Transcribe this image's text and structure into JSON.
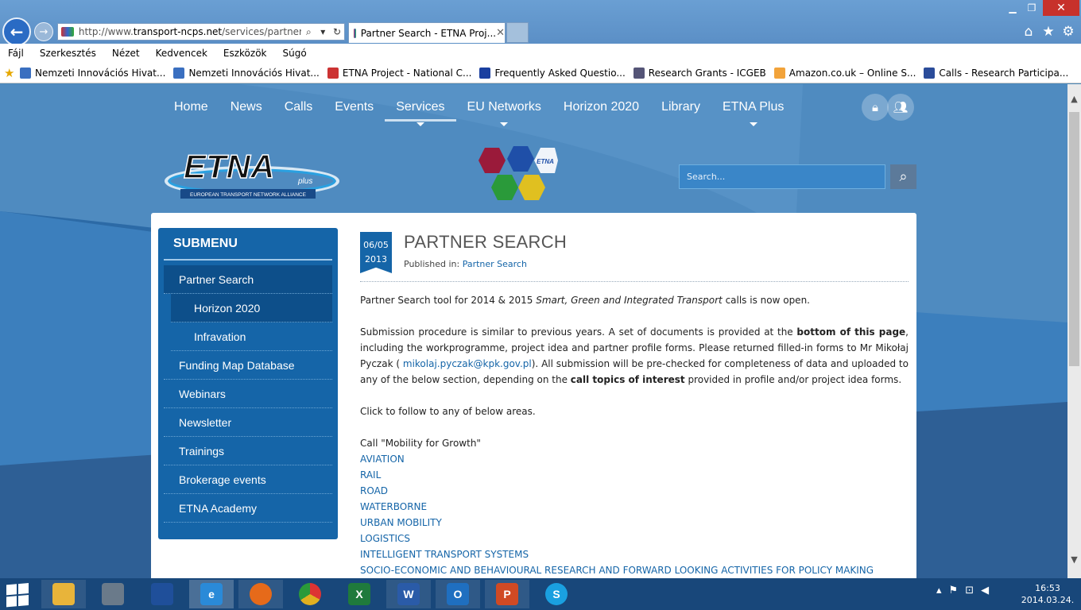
{
  "browser": {
    "url_prefix": "http://www.",
    "url_domain": "transport-ncps.net",
    "url_path": "/services/partner-searc",
    "tab_title": "Partner Search - ETNA Proj...",
    "tab_close": "✕",
    "menu": [
      "Fájl",
      "Szerkesztés",
      "Nézet",
      "Kedvencek",
      "Eszközök",
      "Súgó"
    ],
    "favorites": [
      {
        "label": "Nemzeti Innovációs Hivat...",
        "color": "#3a6fc0"
      },
      {
        "label": "Nemzeti Innovációs Hivat...",
        "color": "#3a6fc0"
      },
      {
        "label": "ETNA Project - National C...",
        "color": "#c33"
      },
      {
        "label": "Frequently Asked Questio...",
        "color": "#1a3fa0"
      },
      {
        "label": "Research Grants - ICGEB",
        "color": "#557"
      },
      {
        "label": "Amazon.co.uk – Online S...",
        "color": "#f2a33a"
      },
      {
        "label": "Calls - Research Participa...",
        "color": "#2b4c9a"
      }
    ]
  },
  "site": {
    "nav": [
      {
        "label": "Home",
        "dropdown": false
      },
      {
        "label": "News",
        "dropdown": false
      },
      {
        "label": "Calls",
        "dropdown": false
      },
      {
        "label": "Events",
        "dropdown": false
      },
      {
        "label": "Services",
        "dropdown": true,
        "active": true
      },
      {
        "label": "EU Networks",
        "dropdown": true
      },
      {
        "label": "Horizon 2020",
        "dropdown": false
      },
      {
        "label": "Library",
        "dropdown": false
      },
      {
        "label": "ETNA Plus",
        "dropdown": true
      }
    ],
    "logo_text": "ETNA",
    "logo_plus": "plus",
    "logo_tagline": "EUROPEAN TRANSPORT NETWORK ALLIANCE",
    "hex_logo_text": "ETNA",
    "search_placeholder": "Search...",
    "submenu": {
      "title": "SUBMENU",
      "items": [
        {
          "label": "Partner Search",
          "active": true,
          "child": false
        },
        {
          "label": "Horizon 2020",
          "active": true,
          "child": true
        },
        {
          "label": "Infravation",
          "active": false,
          "child": true
        },
        {
          "label": "Funding Map Database",
          "active": false,
          "child": false
        },
        {
          "label": "Webinars",
          "active": false,
          "child": false
        },
        {
          "label": "Newsletter",
          "active": false,
          "child": false
        },
        {
          "label": "Trainings",
          "active": false,
          "child": false
        },
        {
          "label": "Brokerage events",
          "active": false,
          "child": false
        },
        {
          "label": "ETNA Academy",
          "active": false,
          "child": false
        }
      ]
    },
    "article": {
      "date_day": "06/05",
      "date_year": "2013",
      "title": "PARTNER SEARCH",
      "published_prefix": "Published in: ",
      "published_link": "Partner Search",
      "p1_a": "Partner Search tool for 2014 & 2015 ",
      "p1_em": "Smart, Green and Integrated Transport",
      "p1_b": " calls is now open.",
      "p2_a": "Submission procedure is similar to previous years. A set of documents is provided at the ",
      "p2_bold1": "bottom of this page",
      "p2_b": ", including the workprogramme, project idea and partner profile forms. Please returned filled-in forms to Mr Mikołaj Pyczak ( ",
      "p2_email": "mikolaj.pyczak@kpk.gov.pl",
      "p2_c": "). All submission will be pre-checked for completeness of data and uploaded to any of the below section, depending on the ",
      "p2_bold2": "call topics of interest",
      "p2_d": " provided in profile and/or project idea forms.",
      "p3": "Click to follow to any of below areas.",
      "call_heading": "Call \"Mobility for Growth\"",
      "areas": [
        "AVIATION",
        "RAIL",
        "ROAD",
        "WATERBORNE",
        "URBAN MOBILITY",
        "LOGISTICS",
        "INTELLIGENT TRANSPORT SYSTEMS",
        "SOCIO-ECONOMIC AND BEHAVIOURAL RESEARCH AND FORWARD LOOKING ACTIVITIES FOR POLICY MAKING"
      ]
    }
  },
  "taskbar": {
    "apps": [
      {
        "name": "file-explorer",
        "label": "",
        "color": "#e8b43a",
        "state": "open"
      },
      {
        "name": "calculator",
        "label": "",
        "color": "#6a7a8a",
        "state": ""
      },
      {
        "name": "save-disk",
        "label": "",
        "color": "#1f4f9a",
        "state": ""
      },
      {
        "name": "internet-explorer",
        "label": "e",
        "color": "#2a8ad8",
        "state": "active"
      },
      {
        "name": "firefox",
        "label": "",
        "color": "#e66a1a",
        "state": "open"
      },
      {
        "name": "chrome",
        "label": "",
        "color": "#e0b020",
        "state": ""
      },
      {
        "name": "excel",
        "label": "X",
        "color": "#1f7a3c",
        "state": ""
      },
      {
        "name": "word",
        "label": "W",
        "color": "#2a5ba8",
        "state": "open"
      },
      {
        "name": "outlook",
        "label": "O",
        "color": "#1f6fc0",
        "state": "open"
      },
      {
        "name": "powerpoint",
        "label": "P",
        "color": "#d04a24",
        "state": "open"
      },
      {
        "name": "skype",
        "label": "S",
        "color": "#1aa0e0",
        "state": ""
      }
    ],
    "time": "16:53",
    "date": "2014.03.24."
  }
}
